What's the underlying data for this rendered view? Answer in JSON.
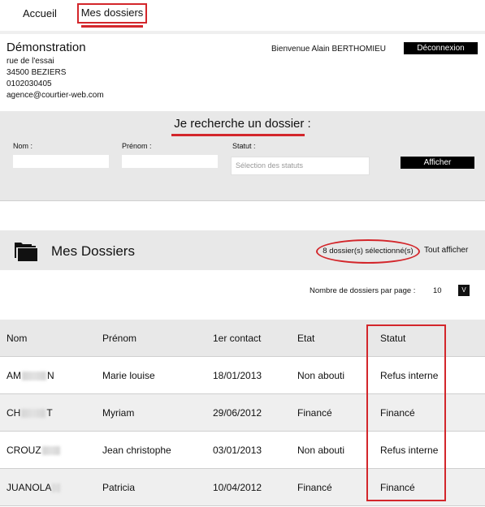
{
  "nav": {
    "home": "Accueil",
    "folders": "Mes dossiers"
  },
  "agency": {
    "name": "Démonstration",
    "street": "rue de l'essai",
    "city": "34500 BEZIERS",
    "phone": "0102030405",
    "email": "agence@courtier-web.com"
  },
  "user": {
    "welcome": "Bienvenue Alain BERTHOMIEU",
    "logout": "Déconnexion"
  },
  "search": {
    "title": "Je recherche un dossier :",
    "nom_label": "Nom :",
    "prenom_label": "Prénom :",
    "statut_label": "Statut :",
    "statut_placeholder": "Sélection des statuts",
    "submit": "Afficher"
  },
  "dossiers": {
    "title": "Mes Dossiers",
    "selected_count": "8 dossier(s) sélectionné(s)",
    "show_all": "Tout afficher",
    "per_page_label": "Nombre de dossiers par page :",
    "per_page_value": "10",
    "per_page_toggle": "V"
  },
  "table": {
    "headers": [
      "Nom",
      "Prénom",
      "1er contact",
      "Etat",
      "Statut"
    ],
    "rows": [
      {
        "nom_start": "AM",
        "nom_end": "N",
        "prenom": "Marie louise",
        "contact": "18/01/2013",
        "etat": "Non abouti",
        "statut": "Refus interne"
      },
      {
        "nom_start": "CH",
        "nom_end": "T",
        "prenom": "Myriam",
        "contact": "29/06/2012",
        "etat": "Financé",
        "statut": "Financé"
      },
      {
        "nom_start": "CROUZ",
        "nom_end": "",
        "prenom": "Jean christophe",
        "contact": "03/01/2013",
        "etat": "Non abouti",
        "statut": "Refus interne"
      },
      {
        "nom_start": "JUANOLA",
        "nom_end": "",
        "prenom": "Patricia",
        "contact": "10/04/2012",
        "etat": "Financé",
        "statut": "Financé"
      }
    ]
  },
  "colors": {
    "accent_red": "#d3262b",
    "panel_gray": "#e8e8e8",
    "button_black": "#000000"
  }
}
